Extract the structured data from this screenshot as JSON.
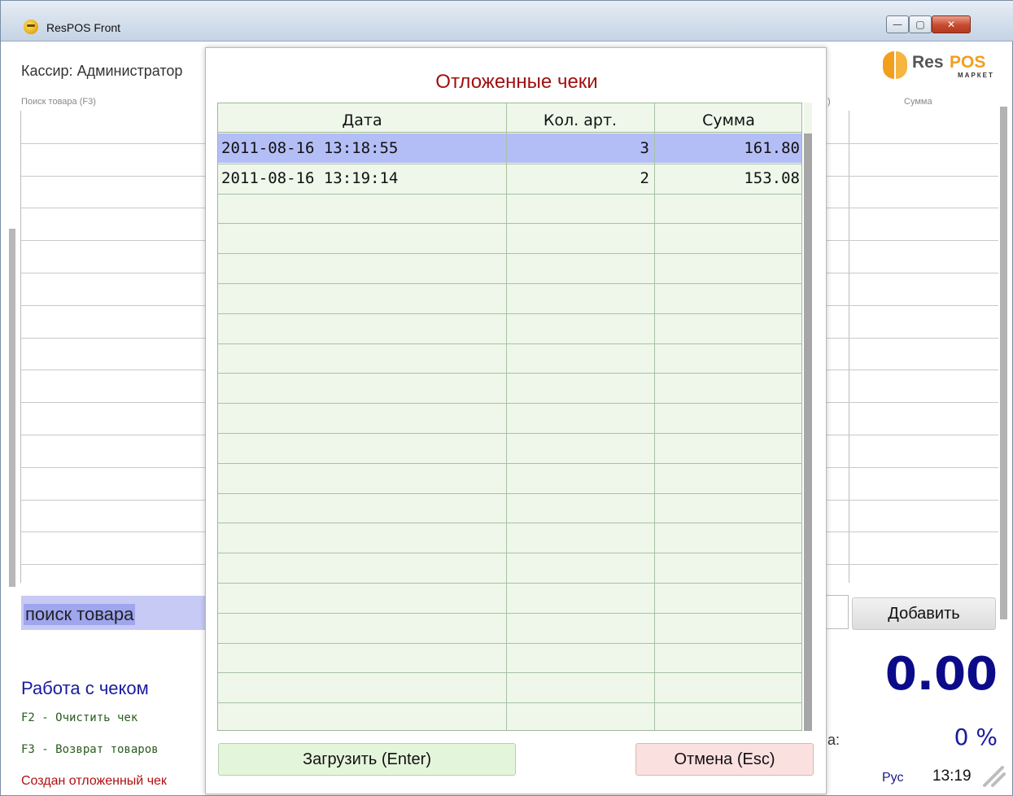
{
  "window": {
    "title": "ResPOS Front",
    "min_glyph": "—",
    "max_glyph": "▢",
    "close_glyph": "✕"
  },
  "left": {
    "cashier": "Кассир: Администратор",
    "search_header": "Поиск товара (F3)",
    "search_text": "поиск товара",
    "work_title": "Работа с чеком",
    "hotkeys": [
      "F2 - Очистить чек",
      "F3 - Возврат товаров"
    ],
    "status_message": "Создан отложенный чек"
  },
  "right": {
    "logo_res": "Res",
    "logo_pos": "POS",
    "logo_sub": "МАРКЕТ",
    "partial_paren": ")",
    "sum_header": "Сумма",
    "add_button": "Добавить",
    "total": "0.00",
    "discount_label": "а:",
    "discount": "0 %",
    "language": "Рус",
    "clock": "13:19"
  },
  "dialog": {
    "title": "Отложенные чеки",
    "columns": [
      "Дата",
      "Кол. арт.",
      "Сумма"
    ],
    "rows": [
      {
        "date": "2011-08-16 13:18:55",
        "qty": "3",
        "sum": "161.80",
        "selected": true
      },
      {
        "date": "2011-08-16 13:19:14",
        "qty": "2",
        "sum": "153.08",
        "selected": false
      }
    ],
    "load_button": "Загрузить (Enter)",
    "cancel_button": "Отмена (Esc)"
  },
  "colors": {
    "dialog_title": "#a01010",
    "table_bg": "#eef7ea",
    "selected_row": "#b4bef6",
    "total": "#0b0b8a",
    "status_message": "#b01010",
    "logo_accent": "#f29e1f"
  }
}
